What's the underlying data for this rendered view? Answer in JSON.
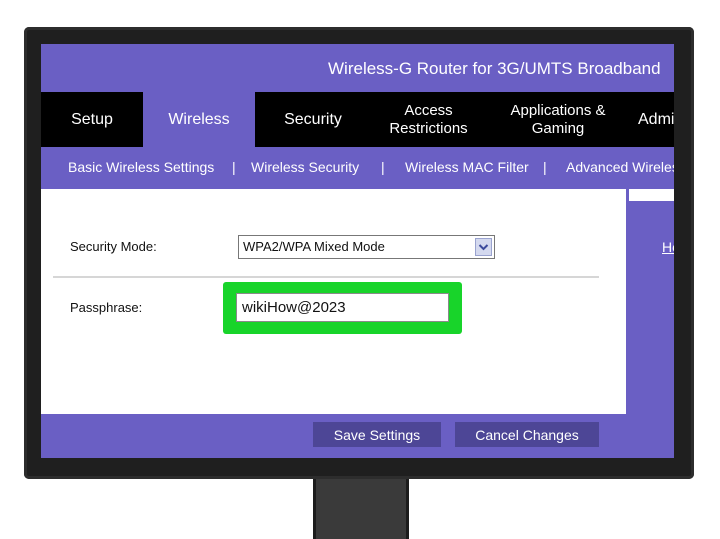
{
  "router": {
    "title": "Wireless-G Router for 3G/UMTS Broadband"
  },
  "tabs": [
    {
      "label": "Setup"
    },
    {
      "label": "Wireless"
    },
    {
      "label": "Security"
    },
    {
      "label_line1": "Access",
      "label_line2": "Restrictions"
    },
    {
      "label_line1": "Applications &",
      "label_line2": "Gaming"
    },
    {
      "label": "Administration"
    }
  ],
  "active_tab": "Wireless",
  "subnav": {
    "items": [
      "Basic Wireless Settings",
      "Wireless Security",
      "Wireless MAC Filter",
      "Advanced Wireless Settings"
    ],
    "separator": "|"
  },
  "form": {
    "security_mode_label": "Security Mode:",
    "security_mode_value": "WPA2/WPA Mixed Mode",
    "passphrase_label": "Passphrase:",
    "passphrase_value": "wikiHow@2023"
  },
  "buttons": {
    "save": "Save Settings",
    "cancel": "Cancel Changes"
  },
  "help": {
    "link": "Help..."
  },
  "colors": {
    "accent": "#6a5fc4",
    "tab_bar": "#000000",
    "button": "#4d4696",
    "highlight": "#18d42a",
    "monitor_bezel": "#1f1f1f"
  },
  "icons": {
    "select_arrow": "chevron-down-icon"
  }
}
